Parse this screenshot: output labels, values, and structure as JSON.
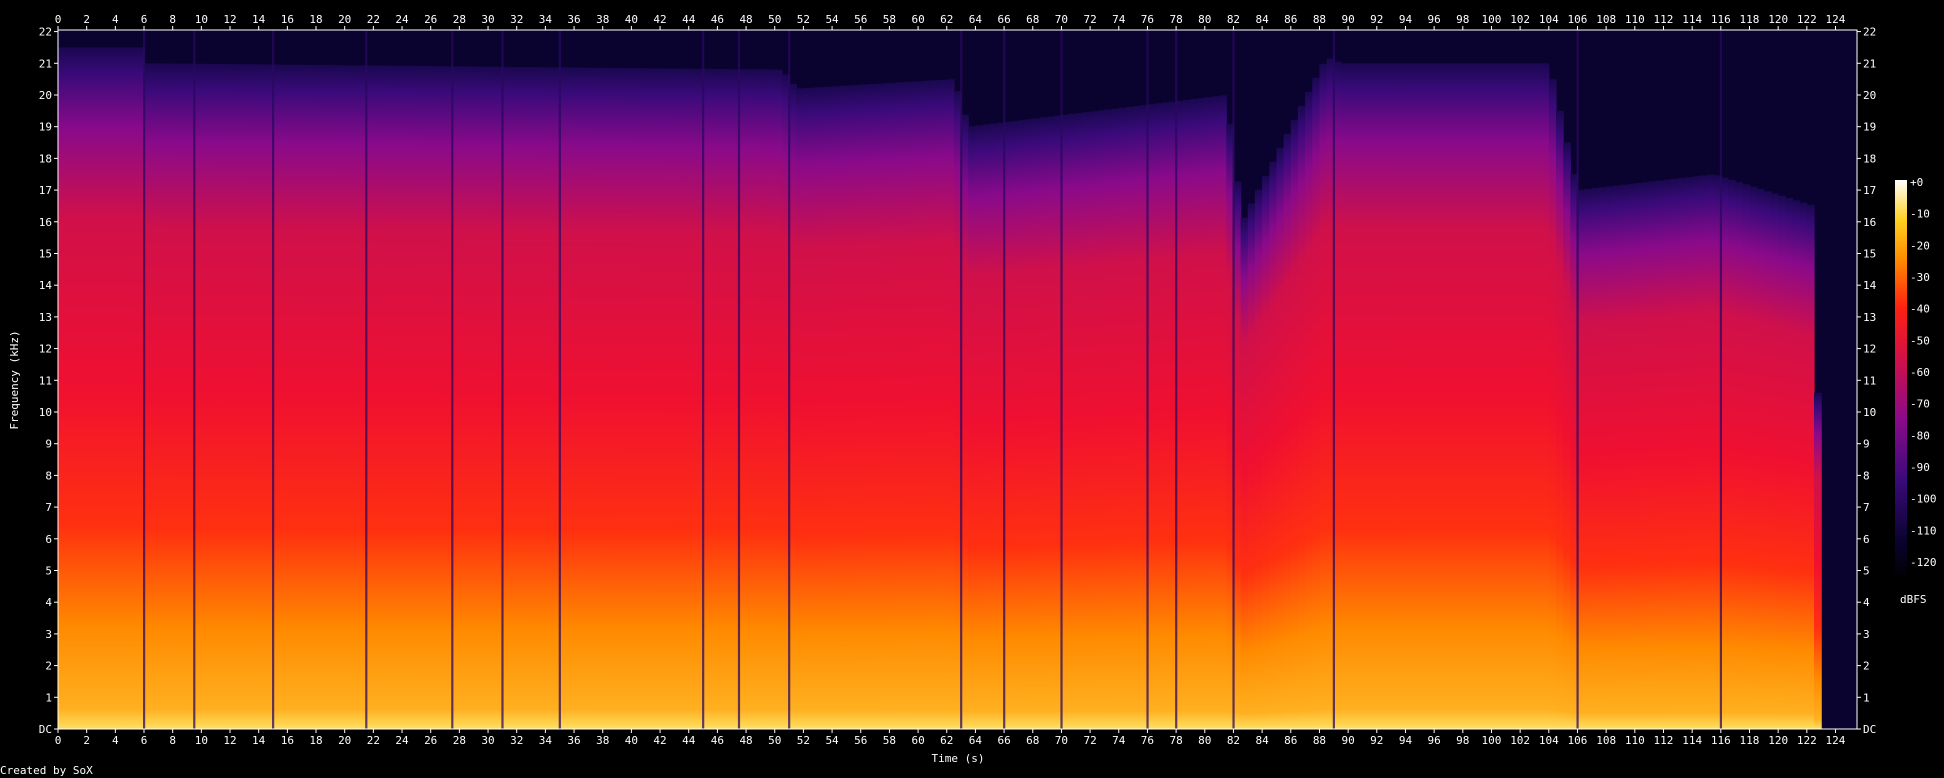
{
  "chart_data": {
    "type": "heatmap",
    "title": "",
    "xlabel": "Time (s)",
    "ylabel": "Frequency (kHz)",
    "xlim": [
      0,
      125.5
    ],
    "ylim": [
      0,
      22.05
    ],
    "x_ticks": [
      "0",
      "2",
      "4",
      "6",
      "8",
      "10",
      "12",
      "14",
      "16",
      "18",
      "20",
      "22",
      "24",
      "26",
      "28",
      "30",
      "32",
      "34",
      "36",
      "38",
      "40",
      "42",
      "44",
      "46",
      "48",
      "50",
      "52",
      "54",
      "56",
      "58",
      "60",
      "62",
      "64",
      "66",
      "68",
      "70",
      "72",
      "74",
      "76",
      "78",
      "80",
      "82",
      "84",
      "86",
      "88",
      "90",
      "92",
      "94",
      "96",
      "98",
      "100",
      "102",
      "104",
      "106",
      "108",
      "110",
      "112",
      "114",
      "116",
      "118",
      "120",
      "122",
      "124"
    ],
    "y_ticks": [
      "DC",
      "1",
      "2",
      "3",
      "4",
      "5",
      "6",
      "7",
      "8",
      "9",
      "10",
      "11",
      "12",
      "13",
      "14",
      "15",
      "16",
      "17",
      "18",
      "19",
      "20",
      "21",
      "22"
    ],
    "colorbar": {
      "unit": "dBFS",
      "ticks": [
        "+0",
        "-10",
        "-20",
        "-30",
        "-40",
        "-50",
        "-60",
        "-70",
        "-80",
        "-90",
        "-100",
        "-110",
        "-120"
      ],
      "range": [
        -120,
        0
      ]
    },
    "energy_profile": {
      "x": [
        0,
        5.8,
        6.2,
        50.5,
        51.5,
        62.5,
        63.5,
        81.5,
        82.6,
        88.5,
        89.5,
        104,
        106,
        115.5,
        122.5,
        123.2,
        125.5
      ],
      "cutoff_khz": [
        21.5,
        21.5,
        21.0,
        20.8,
        20.2,
        20.5,
        19.0,
        20.0,
        16.0,
        21.2,
        21.0,
        21.0,
        17.0,
        17.5,
        16.5,
        0,
        0
      ],
      "note": ""
    },
    "quiet_moments_s": [
      6,
      9.5,
      15,
      21.5,
      27.5,
      31,
      35,
      45,
      47.5,
      51,
      63,
      66,
      70,
      76,
      78,
      82,
      89,
      106,
      116
    ]
  },
  "footer": {
    "credit": "Created by SoX"
  },
  "colors": {
    "background": "#000000",
    "text": "#ffffff"
  }
}
